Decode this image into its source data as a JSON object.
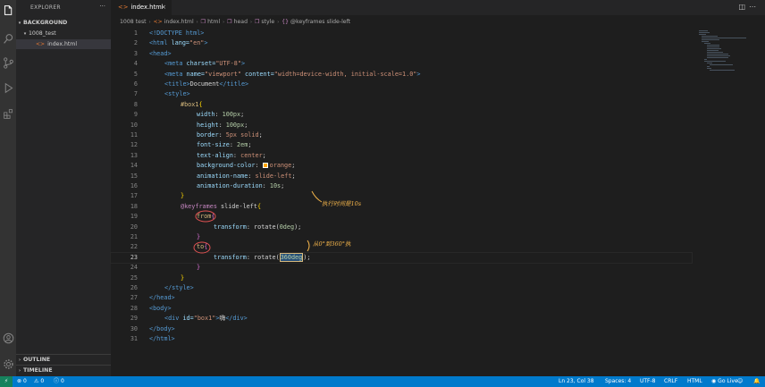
{
  "explorer": {
    "title": "EXPLORER",
    "more": "···",
    "workspace": "BACKGROUND",
    "folder": "1008_test",
    "file": "index.html",
    "outline": "OUTLINE",
    "timeline": "TIMELINE"
  },
  "tab": {
    "label": "index.html",
    "close": "×"
  },
  "breadcrumb": {
    "items": [
      "1008 test",
      "index.html",
      "html",
      "head",
      "style",
      "@keyframes slide-left"
    ]
  },
  "code": {
    "line_numbers": [
      "1",
      "2",
      "3",
      "4",
      "5",
      "6",
      "7",
      "8",
      "9",
      "10",
      "11",
      "12",
      "13",
      "14",
      "15",
      "16",
      "17",
      "18",
      "19",
      "20",
      "21",
      "22",
      "23",
      "24",
      "25",
      "26",
      "27",
      "28",
      "29",
      "30",
      "31"
    ],
    "l1": "<!DOCTYPE html>",
    "l2_tag": "<html",
    "l2_attr": " lang=",
    "l2_val": "\"en\"",
    "l2_end": ">",
    "l3": "<head>",
    "l4_tag": "<meta",
    "l4_attr": " charset=",
    "l4_val": "\"UTF-8\"",
    "l4_end": ">",
    "l5_tag": "<meta",
    "l5_attr1": " name=",
    "l5_val1": "\"viewport\"",
    "l5_attr2": " content=",
    "l5_val2": "\"width=device-width, initial-scale=1.0\"",
    "l5_end": ">",
    "l6_open": "<title>",
    "l6_text": "Document",
    "l6_close": "</title>",
    "l7": "<style>",
    "l8_sel": "#box1",
    "l8_brace": "{",
    "l9_prop": "width",
    "l9_val": "100px",
    "l10_prop": "height",
    "l10_val": "100px",
    "l11_prop": "border",
    "l11_val": "5px solid",
    "l12_prop": "font-size",
    "l12_val": "2em",
    "l13_prop": "text-align",
    "l13_val": "center",
    "l14_prop": "background-color",
    "l14_val": "orange",
    "l15_prop": "animation-name",
    "l15_val": "slide-left",
    "l16_prop": "animation-duration",
    "l16_val": "10s",
    "l17": "}",
    "l18_kw": "@keyframes",
    "l18_name": " slide-left",
    "l18_brace": "{",
    "l19_sel": "from",
    "l19_brace": "{",
    "l20_prop": "transform",
    "l20_fn": "rotate(",
    "l20_num": "0deg",
    "l20_end": ");",
    "l21": "}",
    "l22_sel": "to",
    "l22_brace": "{",
    "l23_prop": "transform",
    "l23_fn": "rotate(",
    "l23_num": "360deg",
    "l23_end": ");",
    "l24": "}",
    "l25": "}",
    "l26": "</style>",
    "l27": "</head>",
    "l28": "<body>",
    "l29_tag": "<div",
    "l29_attr": " id=",
    "l29_val": "\"box1\"",
    "l29_gt": ">",
    "l29_text": "嗨",
    "l29_close": "</div>",
    "l30": "</body>",
    "l31": "</html>"
  },
  "annotations": {
    "a1": "执行时间是10s",
    "a2": "从0°到360°执"
  },
  "status": {
    "errors": "0",
    "warnings": "0",
    "info": "0",
    "position": "Ln 23, Col 38",
    "spaces": "Spaces: 4",
    "encoding": "UTF-8",
    "eol": "CRLF",
    "language": "HTML",
    "golive": "Go Live"
  },
  "colors": {
    "status_bar": "#007acc",
    "editor_bg": "#1e1e1e",
    "sidebar_bg": "#252526",
    "activity_bg": "#333333",
    "swatch": "#ffa500",
    "annotation": "#f0b24a"
  }
}
